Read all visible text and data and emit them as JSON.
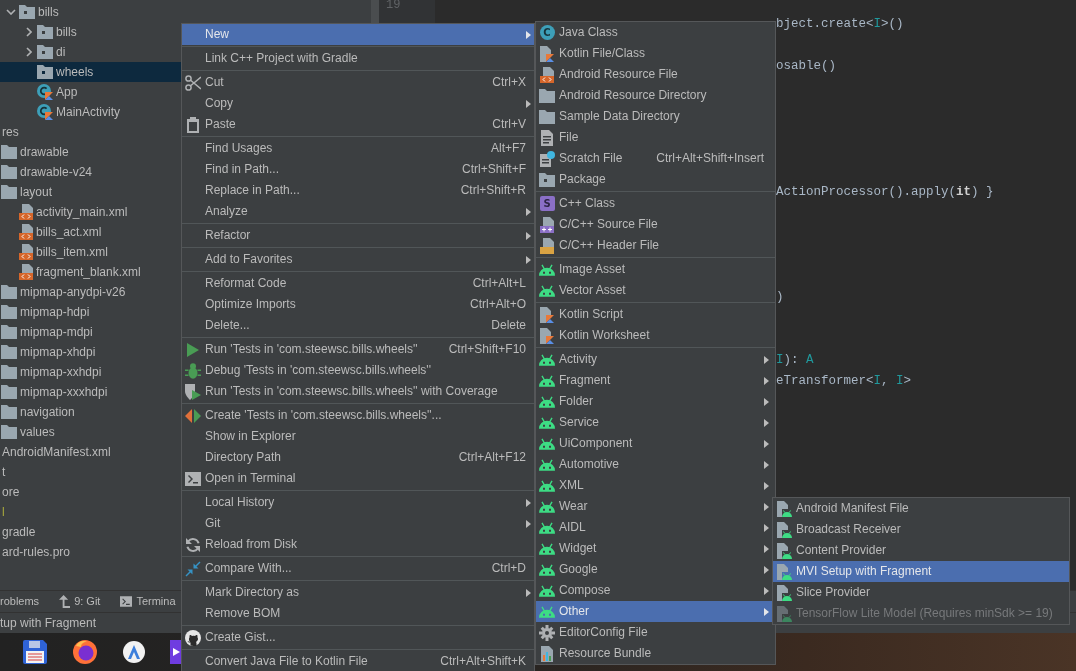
{
  "project_tree": [
    {
      "label": "bills",
      "kind": "package",
      "expanded": true,
      "selected": false,
      "children": [
        {
          "label": "bills",
          "kind": "package",
          "expanded": false,
          "selected": false
        },
        {
          "label": "di",
          "kind": "package",
          "expanded": false,
          "selected": false
        },
        {
          "label": "wheels",
          "kind": "package",
          "selected": true
        },
        {
          "label": "App",
          "kind": "kotlinclass",
          "selected": false
        },
        {
          "label": "MainActivity",
          "kind": "kotlinclass",
          "selected": false
        }
      ]
    },
    {
      "label": "res",
      "kind": "plain",
      "selected": false,
      "children": [
        {
          "label": "drawable",
          "kind": "folder",
          "selected": false
        },
        {
          "label": "drawable-v24",
          "kind": "folder",
          "selected": false
        },
        {
          "label": "layout",
          "kind": "folder",
          "selected": false,
          "children": [
            {
              "label": "activity_main.xml",
              "kind": "layout",
              "selected": false
            },
            {
              "label": "bills_act.xml",
              "kind": "layout",
              "selected": false
            },
            {
              "label": "bills_item.xml",
              "kind": "layout",
              "selected": false
            },
            {
              "label": "fragment_blank.xml",
              "kind": "layout",
              "selected": false
            }
          ]
        },
        {
          "label": "mipmap-anydpi-v26",
          "kind": "folder",
          "selected": false
        },
        {
          "label": "mipmap-hdpi",
          "kind": "folder",
          "selected": false
        },
        {
          "label": "mipmap-mdpi",
          "kind": "folder",
          "selected": false
        },
        {
          "label": "mipmap-xhdpi",
          "kind": "folder",
          "selected": false
        },
        {
          "label": "mipmap-xxhdpi",
          "kind": "folder",
          "selected": false
        },
        {
          "label": "mipmap-xxxhdpi",
          "kind": "folder",
          "selected": false
        },
        {
          "label": "navigation",
          "kind": "folder",
          "selected": false
        },
        {
          "label": "values",
          "kind": "folder",
          "selected": false
        }
      ]
    },
    {
      "label": "AndroidManifest.xml",
      "kind": "plain",
      "selected": false
    },
    {
      "label": "t",
      "kind": "plain",
      "selected": false
    },
    {
      "label": "ore",
      "kind": "plain",
      "selected": false
    },
    {
      "label": "l",
      "kind": "plain",
      "selected": false,
      "color": "#a8a83c"
    },
    {
      "label": "gradle",
      "kind": "plain",
      "selected": false
    },
    {
      "label": "ard-rules.pro",
      "kind": "plain",
      "selected": false
    }
  ],
  "gutter": {
    "line_numbers": [
      "19"
    ]
  },
  "editor": {
    "lines": [
      {
        "kind": "code",
        "tokens": [
          {
            "text": "bject.create<",
            "kind": "plain"
          },
          {
            "text": "I",
            "kind": "type"
          },
          {
            "text": ">()",
            "kind": "plain"
          }
        ]
      },
      {
        "kind": "blank"
      },
      {
        "kind": "code",
        "tokens": [
          {
            "text": "osable()",
            "kind": "plain"
          }
        ]
      },
      {
        "kind": "blank"
      },
      {
        "kind": "blank"
      },
      {
        "kind": "blank"
      },
      {
        "kind": "blank"
      },
      {
        "kind": "blank"
      },
      {
        "kind": "code",
        "tokens": [
          {
            "text": "ActionProcessor().apply(**it**) }",
            "kind": "plain"
          }
        ]
      },
      {
        "kind": "blank"
      },
      {
        "kind": "blank"
      },
      {
        "kind": "blank"
      },
      {
        "kind": "blank"
      },
      {
        "kind": "code",
        "tokens": [
          {
            "text": ")",
            "kind": "plain"
          }
        ]
      },
      {
        "kind": "blank"
      },
      {
        "kind": "blank"
      },
      {
        "kind": "code",
        "tokens": [
          {
            "text": "I",
            "kind": "type"
          },
          {
            "text": "): ",
            "kind": "plain"
          },
          {
            "text": "A",
            "kind": "type"
          }
        ]
      },
      {
        "kind": "code",
        "tokens": [
          {
            "text": "eTransformer<",
            "kind": "plain"
          },
          {
            "text": "I",
            "kind": "type"
          },
          {
            "text": ", ",
            "kind": "plain"
          },
          {
            "text": "I",
            "kind": "type"
          },
          {
            "text": ">",
            "kind": "plain"
          }
        ]
      }
    ]
  },
  "tool_window_bar": [
    {
      "label": "roblems",
      "kind": "plain"
    },
    {
      "label": "9: Git",
      "kind": "git"
    },
    {
      "label": "Termina",
      "kind": "terminal"
    }
  ],
  "status_bar": {
    "text": "tup with Fragment"
  },
  "context_menu": {
    "items": [
      {
        "label": "New",
        "kind": "plain",
        "selected": true,
        "submenu": true
      },
      {
        "kind": "separator"
      },
      {
        "label": "Link C++ Project with Gradle",
        "kind": "plain",
        "selected": false
      },
      {
        "kind": "separator"
      },
      {
        "label": "Cut",
        "kind": "cut",
        "shortcut": "Ctrl+X",
        "selected": false
      },
      {
        "label": "Copy",
        "kind": "plain",
        "selected": false,
        "submenu": true
      },
      {
        "label": "Paste",
        "kind": "paste",
        "shortcut": "Ctrl+V",
        "selected": false
      },
      {
        "kind": "separator"
      },
      {
        "label": "Find Usages",
        "kind": "plain",
        "shortcut": "Alt+F7",
        "selected": false
      },
      {
        "label": "Find in Path...",
        "kind": "plain",
        "shortcut": "Ctrl+Shift+F",
        "selected": false
      },
      {
        "label": "Replace in Path...",
        "kind": "plain",
        "shortcut": "Ctrl+Shift+R",
        "selected": false
      },
      {
        "label": "Analyze",
        "kind": "plain",
        "selected": false,
        "submenu": true
      },
      {
        "kind": "separator"
      },
      {
        "label": "Refactor",
        "kind": "plain",
        "selected": false,
        "submenu": true
      },
      {
        "kind": "separator"
      },
      {
        "label": "Add to Favorites",
        "kind": "plain",
        "selected": false,
        "submenu": true
      },
      {
        "kind": "separator"
      },
      {
        "label": "Reformat Code",
        "kind": "plain",
        "shortcut": "Ctrl+Alt+L",
        "selected": false
      },
      {
        "label": "Optimize Imports",
        "kind": "plain",
        "shortcut": "Ctrl+Alt+O",
        "selected": false
      },
      {
        "label": "Delete...",
        "kind": "plain",
        "shortcut": "Delete",
        "selected": false
      },
      {
        "kind": "separator"
      },
      {
        "label": "Run 'Tests in 'com.steewsc.bills.wheels''",
        "kind": "run",
        "shortcut": "Ctrl+Shift+F10",
        "selected": false
      },
      {
        "label": "Debug 'Tests in 'com.steewsc.bills.wheels''",
        "kind": "debug",
        "selected": false
      },
      {
        "label": "Run 'Tests in 'com.steewsc.bills.wheels'' with Coverage",
        "kind": "coverage",
        "selected": false
      },
      {
        "kind": "separator"
      },
      {
        "label": "Create 'Tests in 'com.steewsc.bills.wheels''...",
        "kind": "testcreate",
        "selected": false
      },
      {
        "label": "Show in Explorer",
        "kind": "plain",
        "selected": false
      },
      {
        "label": "Directory Path",
        "kind": "plain",
        "shortcut": "Ctrl+Alt+F12",
        "selected": false
      },
      {
        "label": "Open in Terminal",
        "kind": "terminal",
        "selected": false
      },
      {
        "kind": "separator"
      },
      {
        "label": "Local History",
        "kind": "plain",
        "selected": false,
        "submenu": true
      },
      {
        "label": "Git",
        "kind": "plain",
        "selected": false,
        "submenu": true
      },
      {
        "label": "Reload from Disk",
        "kind": "reload",
        "selected": false
      },
      {
        "kind": "separator"
      },
      {
        "label": "Compare With...",
        "kind": "compare",
        "shortcut": "Ctrl+D",
        "selected": false
      },
      {
        "kind": "separator"
      },
      {
        "label": "Mark Directory as",
        "kind": "plain",
        "selected": false,
        "submenu": true
      },
      {
        "label": "Remove BOM",
        "kind": "plain",
        "selected": false
      },
      {
        "kind": "separator"
      },
      {
        "label": "Create Gist...",
        "kind": "gist",
        "selected": false
      },
      {
        "kind": "separator"
      },
      {
        "label": "Convert Java File to Kotlin File",
        "kind": "plain",
        "shortcut": "Ctrl+Alt+Shift+K",
        "selected": false
      }
    ]
  },
  "new_submenu": {
    "items": [
      {
        "label": "Java Class",
        "kind": "javaclass",
        "badge": "C",
        "selected": false
      },
      {
        "label": "Kotlin File/Class",
        "kind": "kotlin",
        "selected": false
      },
      {
        "label": "Android Resource File",
        "kind": "resfile",
        "selected": false
      },
      {
        "label": "Android Resource Directory",
        "kind": "folder",
        "selected": false
      },
      {
        "label": "Sample Data Directory",
        "kind": "folder",
        "selected": false
      },
      {
        "label": "File",
        "kind": "file",
        "selected": false
      },
      {
        "label": "Scratch File",
        "kind": "scratch",
        "shortcut": "Ctrl+Alt+Shift+Insert",
        "selected": false
      },
      {
        "label": "Package",
        "kind": "package",
        "selected": false
      },
      {
        "kind": "separator"
      },
      {
        "label": "C++ Class",
        "kind": "cppclass",
        "badge": "S",
        "selected": false
      },
      {
        "label": "C/C++ Source File",
        "kind": "cppsource",
        "selected": false
      },
      {
        "label": "C/C++ Header File",
        "kind": "cppheader",
        "selected": false
      },
      {
        "kind": "separator"
      },
      {
        "label": "Image Asset",
        "kind": "android",
        "selected": false
      },
      {
        "label": "Vector Asset",
        "kind": "android",
        "selected": false
      },
      {
        "kind": "separator"
      },
      {
        "label": "Kotlin Script",
        "kind": "kotlinscript",
        "selected": false
      },
      {
        "label": "Kotlin Worksheet",
        "kind": "kotlinscript",
        "selected": false
      },
      {
        "kind": "separator"
      },
      {
        "label": "Activity",
        "kind": "android",
        "selected": false,
        "submenu": true
      },
      {
        "label": "Fragment",
        "kind": "android",
        "selected": false,
        "submenu": true
      },
      {
        "label": "Folder",
        "kind": "android",
        "selected": false,
        "submenu": true
      },
      {
        "label": "Service",
        "kind": "android",
        "selected": false,
        "submenu": true
      },
      {
        "label": "UiComponent",
        "kind": "android",
        "selected": false,
        "submenu": true
      },
      {
        "label": "Automotive",
        "kind": "android",
        "selected": false,
        "submenu": true
      },
      {
        "label": "XML",
        "kind": "android",
        "selected": false,
        "submenu": true
      },
      {
        "label": "Wear",
        "kind": "android",
        "selected": false,
        "submenu": true
      },
      {
        "label": "AIDL",
        "kind": "android",
        "selected": false,
        "submenu": true
      },
      {
        "label": "Widget",
        "kind": "android",
        "selected": false,
        "submenu": true
      },
      {
        "label": "Google",
        "kind": "android",
        "selected": false,
        "submenu": true
      },
      {
        "label": "Compose",
        "kind": "android",
        "selected": false,
        "submenu": true
      },
      {
        "label": "Other",
        "kind": "android",
        "selected": true,
        "submenu": true
      },
      {
        "label": "EditorConfig File",
        "kind": "gear",
        "selected": false
      },
      {
        "label": "Resource Bundle",
        "kind": "bundle",
        "selected": false
      }
    ]
  },
  "other_submenu": {
    "items": [
      {
        "label": "Android Manifest File",
        "kind": "androidfile",
        "selected": false,
        "disabled": false
      },
      {
        "label": "Broadcast Receiver",
        "kind": "androidfile",
        "selected": false,
        "disabled": false
      },
      {
        "label": "Content Provider",
        "kind": "androidfile",
        "selected": false,
        "disabled": false
      },
      {
        "label": "MVI Setup with Fragment",
        "kind": "androidfile",
        "selected": true,
        "disabled": false
      },
      {
        "label": "Slice Provider",
        "kind": "androidfile",
        "selected": false,
        "disabled": false
      },
      {
        "label": "TensorFlow Lite Model (Requires minSdk >= 19)",
        "kind": "androidfile",
        "selected": false,
        "disabled": true
      }
    ]
  }
}
